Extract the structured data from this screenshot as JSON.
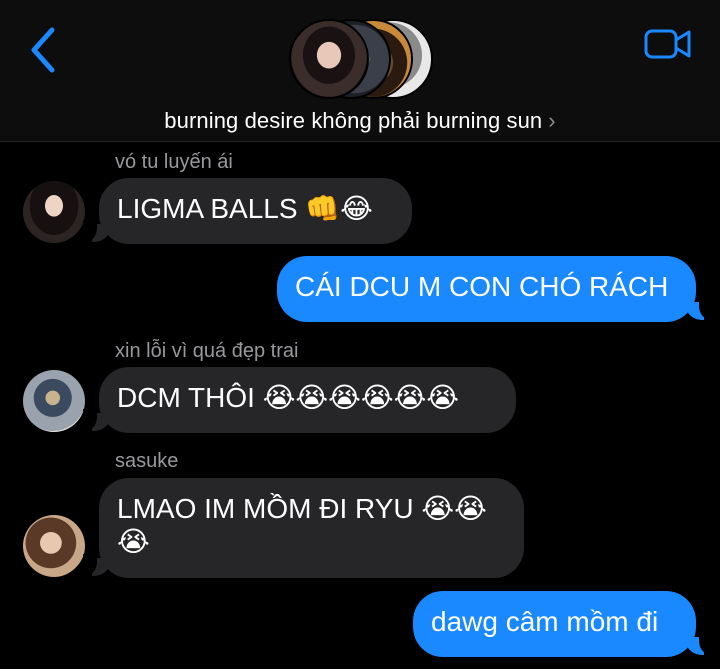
{
  "header": {
    "back_icon": "chevron-left-icon",
    "video_icon": "video-camera-icon",
    "chat_name": "burning desire không phải burning sun",
    "chevron": "›",
    "accent_color": "#1a88ff"
  },
  "messages": [
    {
      "direction": "incoming",
      "sender": "vó tu luyến ái",
      "text": "LIGMA BALLS 👊😂"
    },
    {
      "direction": "outgoing",
      "text": "CÁI DCU M CON CHÓ RÁCH"
    },
    {
      "direction": "incoming",
      "sender": "xin lỗi vì quá đẹp trai",
      "text": "DCM THÔI 😭😭😭😭😭😭"
    },
    {
      "direction": "incoming",
      "sender": "sasuke",
      "text": "LMAO IM MỒM ĐI RYU 😭😭 😭"
    },
    {
      "direction": "outgoing",
      "text": "dawg câm mồm đi"
    }
  ],
  "colors": {
    "incoming_bubble": "#262628",
    "outgoing_bubble": "#1a88ff",
    "background": "#000000"
  }
}
